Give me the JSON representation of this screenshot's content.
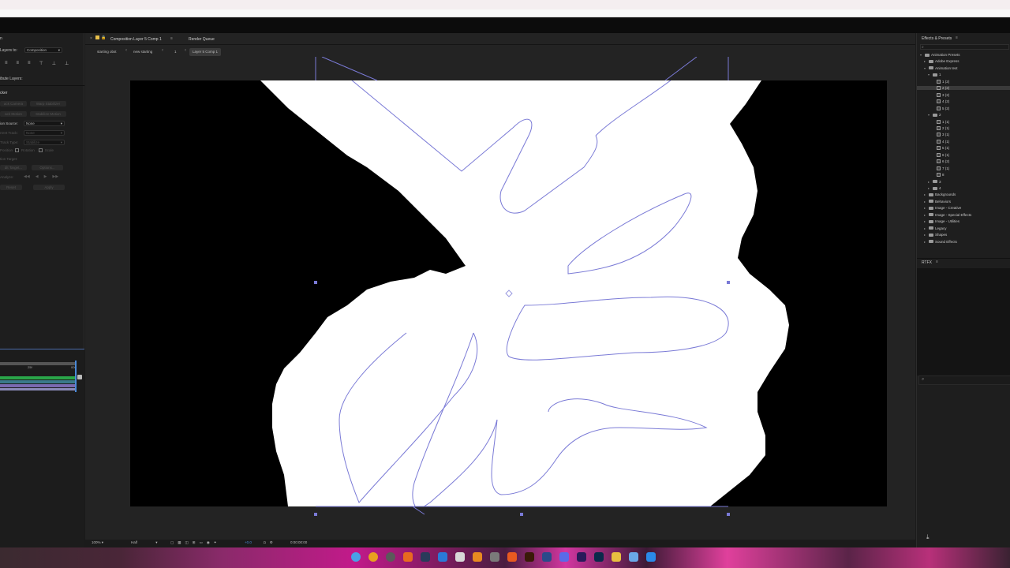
{
  "left_panel": {
    "align_header": "n",
    "layers_to_label": "Layers to:",
    "layers_to_value": "Composition",
    "distribute_label": "ibute Layers:",
    "tracker_header": "cker",
    "buttons": [
      "ack Camera",
      "Warp Stabilizer",
      "ack Motion",
      "Stabilize Motion"
    ],
    "motion_source_label": "ion Source:",
    "motion_source_value": "None",
    "current_track_label": "rrent Track:",
    "current_track_value": "None",
    "track_type_label": "Track Type:",
    "track_type_value": "Stabilize",
    "position_label": "Position",
    "rotation_label": "Rotation",
    "scale_label": "Scale",
    "motion_target_label": "tion Target:",
    "edit_target_label": "dit Target...",
    "options_label": "Options...",
    "analyze_label": "Analyze:",
    "reset_label": "Reset",
    "apply_label": "Apply",
    "timeline_marker_1": "25f",
    "timeline_marker_2": "00f"
  },
  "viewer": {
    "tab_composition": "Composition Layer 5 Comp 1",
    "tab_render_queue": "Render Queue",
    "breadcrumbs": [
      "starting obst",
      "new starting",
      "1",
      "Layer 5 Comp 1"
    ],
    "zoom": "100%",
    "resolution": "Half",
    "exposure": "+0.0",
    "timecode": "0:00:00:00"
  },
  "effects_panel": {
    "header": "Effects & Presets",
    "tree": [
      {
        "label": "Animation Presets",
        "level": 0,
        "type": "folder",
        "open": true
      },
      {
        "label": "Adobe Express",
        "level": 1,
        "type": "folder",
        "open": false
      },
      {
        "label": "Animation text",
        "level": 1,
        "type": "folder",
        "open": true
      },
      {
        "label": "1",
        "level": 2,
        "type": "folder",
        "open": true
      },
      {
        "label": "1 (2)",
        "level": 3,
        "type": "file"
      },
      {
        "label": "2 (2)",
        "level": 3,
        "type": "file",
        "selected": true
      },
      {
        "label": "3 (2)",
        "level": 3,
        "type": "file"
      },
      {
        "label": "4 (2)",
        "level": 3,
        "type": "file"
      },
      {
        "label": "5 (2)",
        "level": 3,
        "type": "file"
      },
      {
        "label": "2",
        "level": 2,
        "type": "folder",
        "open": true
      },
      {
        "label": "1 (1)",
        "level": 3,
        "type": "file"
      },
      {
        "label": "2 (1)",
        "level": 3,
        "type": "file"
      },
      {
        "label": "3 (1)",
        "level": 3,
        "type": "file"
      },
      {
        "label": "4 (1)",
        "level": 3,
        "type": "file"
      },
      {
        "label": "5 (1)",
        "level": 3,
        "type": "file"
      },
      {
        "label": "6 (1)",
        "level": 3,
        "type": "file"
      },
      {
        "label": "6 (2)",
        "level": 3,
        "type": "file"
      },
      {
        "label": "7 (1)",
        "level": 3,
        "type": "file"
      },
      {
        "label": "8",
        "level": 3,
        "type": "file"
      },
      {
        "label": "3",
        "level": 2,
        "type": "folder",
        "open": false
      },
      {
        "label": "4",
        "level": 2,
        "type": "folder",
        "open": false
      },
      {
        "label": "Backgrounds",
        "level": 1,
        "type": "folder",
        "open": false
      },
      {
        "label": "Behaviors",
        "level": 1,
        "type": "folder",
        "open": false
      },
      {
        "label": "Image - Creative",
        "level": 1,
        "type": "folder",
        "open": false
      },
      {
        "label": "Image - Special Effects",
        "level": 1,
        "type": "folder",
        "open": false
      },
      {
        "label": "Image - Utilities",
        "level": 1,
        "type": "folder",
        "open": false
      },
      {
        "label": "Legacy",
        "level": 1,
        "type": "folder",
        "open": false
      },
      {
        "label": "Shapes",
        "level": 1,
        "type": "folder",
        "open": false
      },
      {
        "label": "Sound Effects",
        "level": 1,
        "type": "folder",
        "open": false
      }
    ],
    "rtfx_header": "RTFX"
  },
  "taskbar": {
    "icons": [
      "chrome-icon",
      "app-r-icon",
      "davinci-icon",
      "firefox-icon",
      "steam-icon",
      "app-blue-icon",
      "timer-icon",
      "vlc-icon",
      "obs-icon",
      "app-orange-icon",
      "illustrator-icon",
      "blender-icon",
      "discord-icon",
      "after-effects-icon",
      "photoshop-icon",
      "folder-icon",
      "copilot-icon",
      "windows-icon"
    ]
  },
  "colors": {
    "accent_purple": "#7a7ad6",
    "ui_bg": "#1e1e1e",
    "taskbar_pink": "#c21a8a"
  }
}
